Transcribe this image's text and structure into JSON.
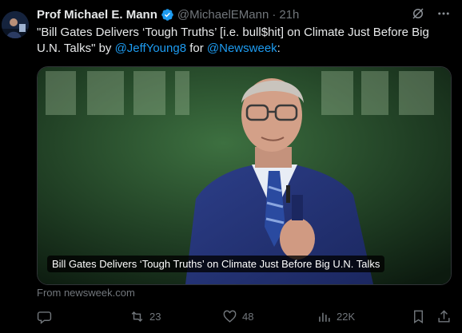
{
  "author": {
    "name": "Prof Michael E. Mann",
    "handle": "@MichaelEMann",
    "separator": "·",
    "time": "21h"
  },
  "tweet": {
    "text_prefix": "\"Bill Gates Delivers ‘Tough Truths’ [i.e. bull$hit] on Climate Just Before Big U.N. Talks\" by ",
    "mention_1": "@JeffYoung8",
    "text_mid": " for ",
    "mention_2": "@Newsweek",
    "text_suffix": ":"
  },
  "card": {
    "caption": "Bill Gates Delivers ‘Tough Truths’ on Climate Just Before Big U.N. Talks",
    "source": "From newsweek.com"
  },
  "actions": {
    "replies": "",
    "retweets": "23",
    "likes": "48",
    "views": "22K"
  },
  "icons": {
    "verified": "verified-badge-icon",
    "grok": "grok-icon",
    "more": "more-icon",
    "reply": "reply-icon",
    "retweet": "retweet-icon",
    "like": "like-icon",
    "views": "views-icon",
    "bookmark": "bookmark-icon",
    "share": "share-icon"
  },
  "colors": {
    "background": "#000000",
    "text": "#e7e9ea",
    "muted": "#71767b",
    "accent": "#1d9bf0"
  }
}
